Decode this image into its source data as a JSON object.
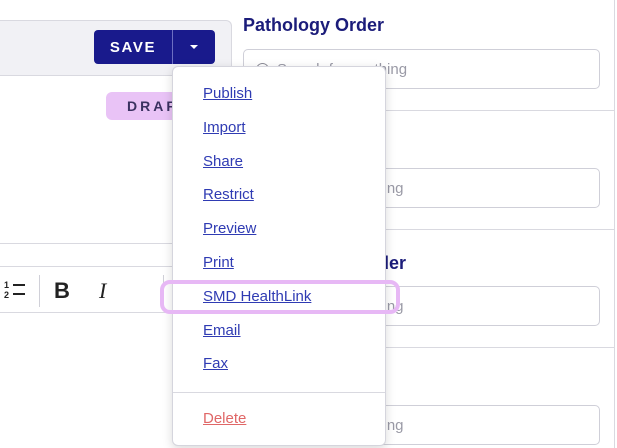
{
  "toolbar": {
    "save_label": "SAVE"
  },
  "status": {
    "draft_label": "DRAFT"
  },
  "editor_toolbar": {
    "list_n1": "1",
    "list_n2": "2",
    "bold": "B",
    "italic": "I"
  },
  "right_panel": {
    "section1_title": "Pathology Order",
    "section3_title_tail": "der",
    "search_placeholder_full": "Search for anything",
    "search_placeholder_tail": "thing"
  },
  "dropdown_menu": {
    "items": [
      "Publish",
      "Import",
      "Share",
      "Restrict",
      "Preview",
      "Print",
      "SMD HealthLink",
      "Email",
      "Fax"
    ],
    "delete_label": "Delete"
  },
  "colors": {
    "brand": "#191a8c",
    "link": "#2f3bb3",
    "danger": "#e06767",
    "badge": "#e9c3f6",
    "highlight": "#e7b8f5"
  }
}
